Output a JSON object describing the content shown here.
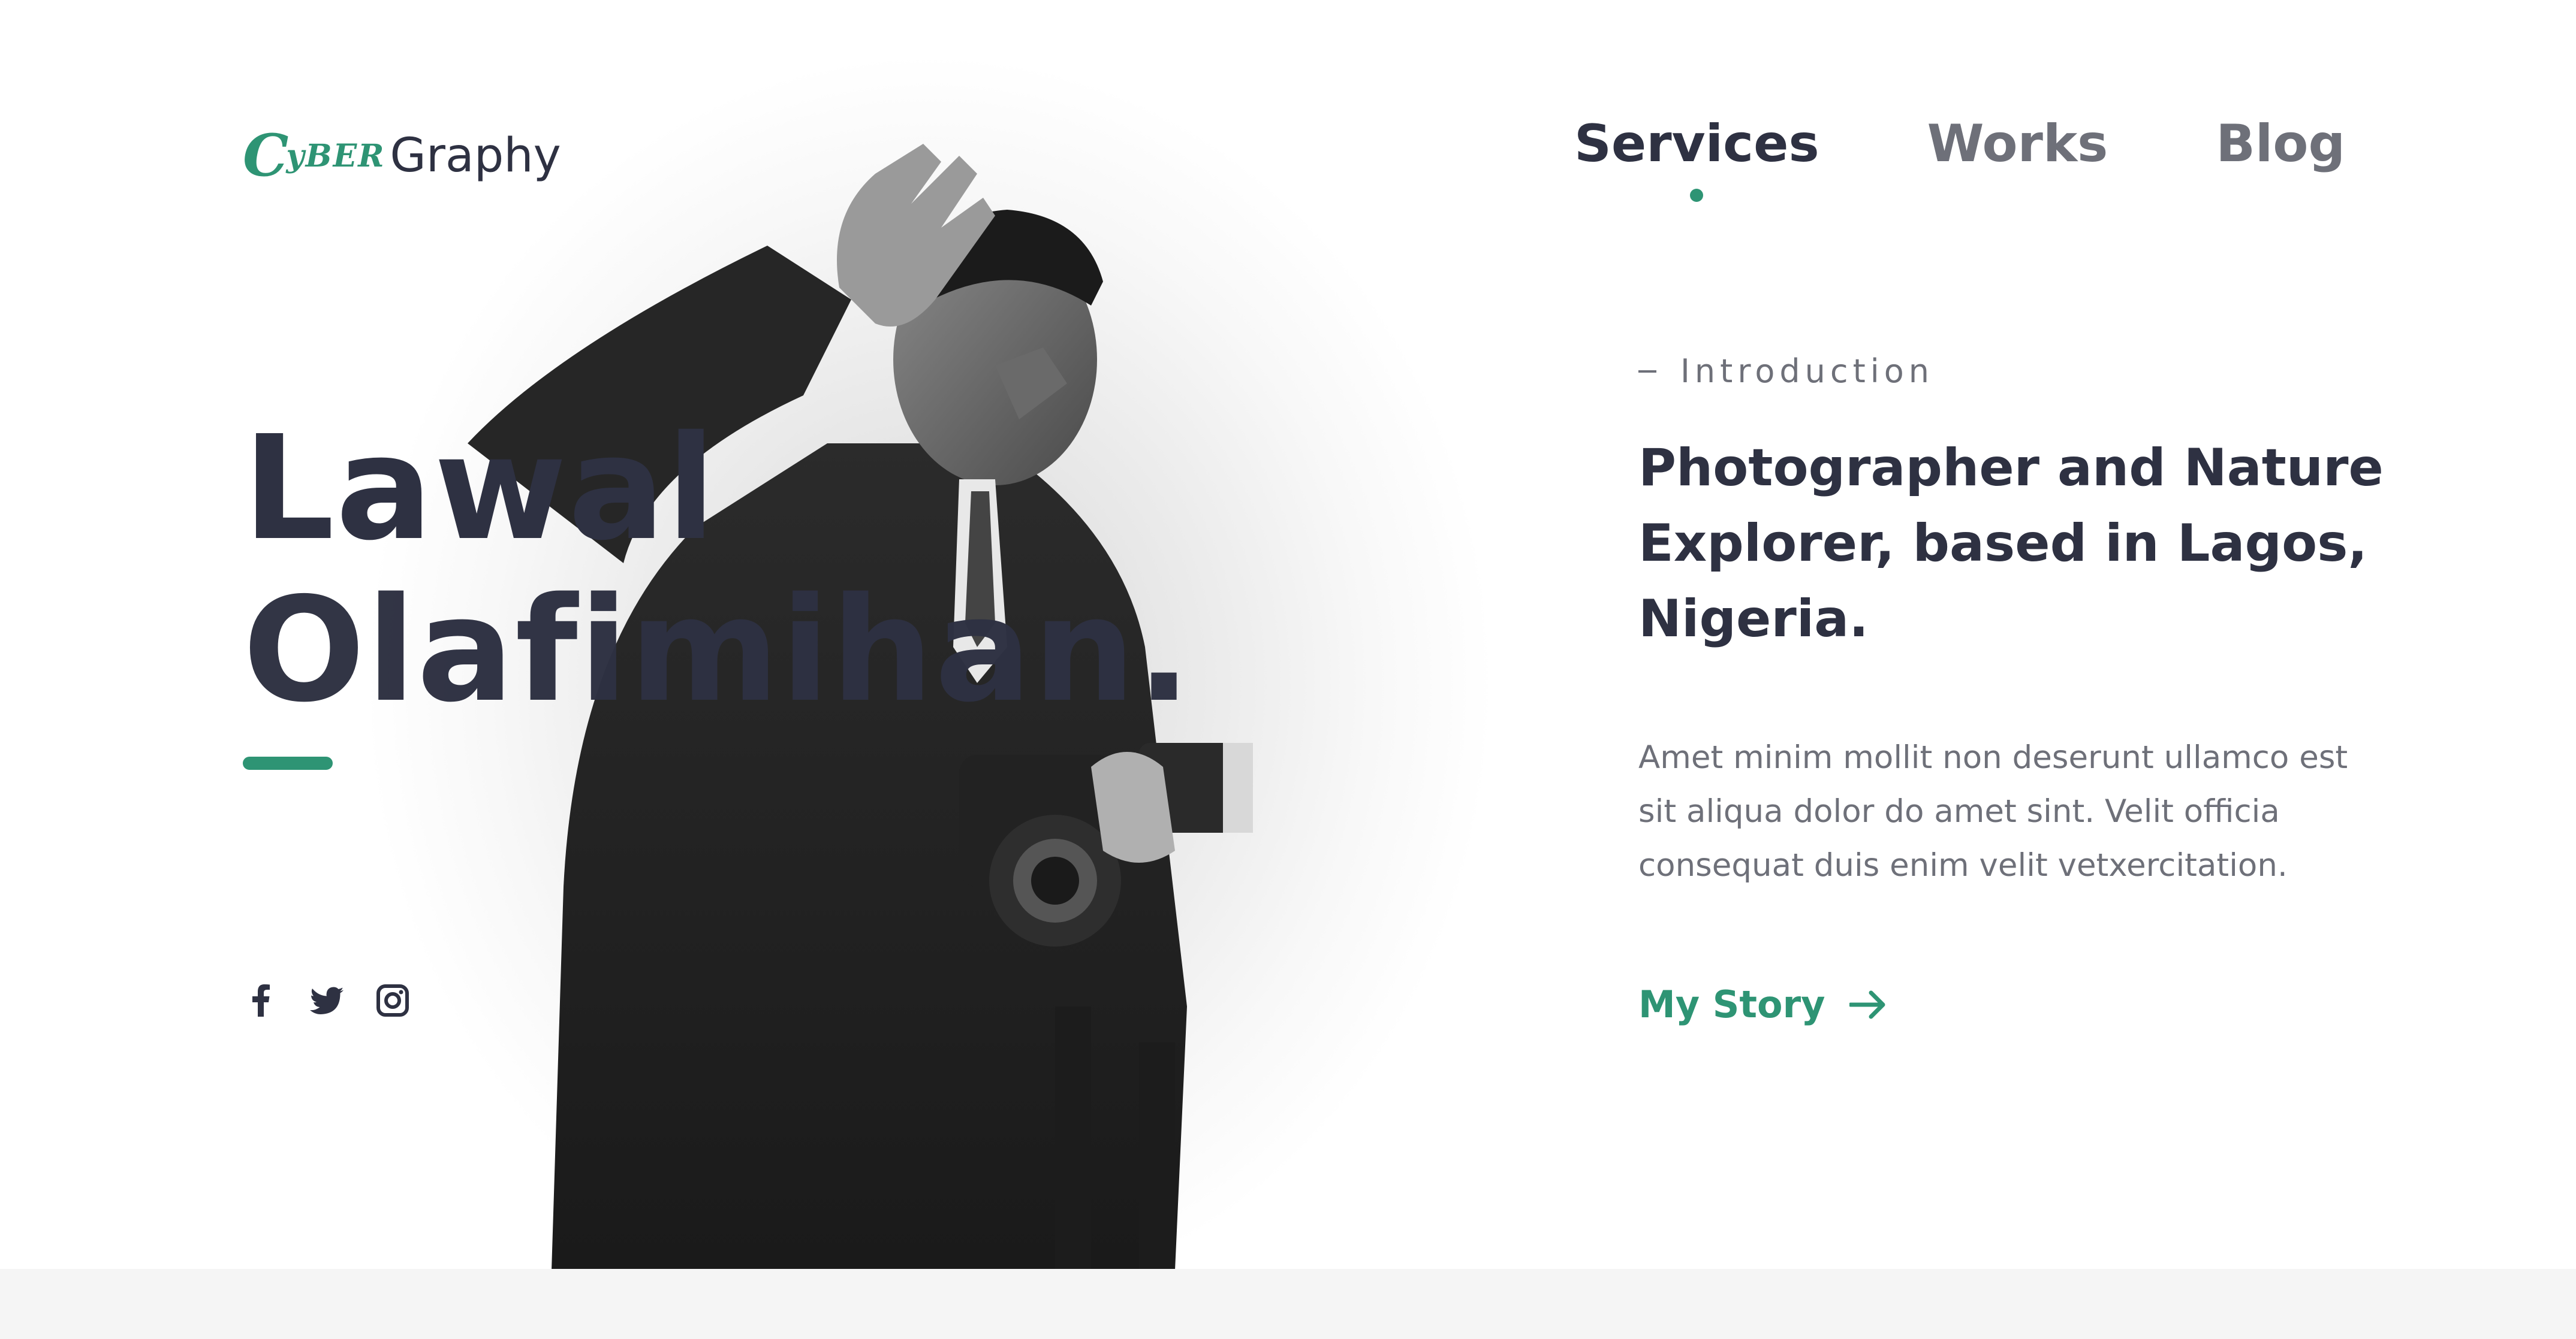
{
  "logo": {
    "mark": "C",
    "accent": "yBER",
    "word": "Graphy"
  },
  "nav": {
    "items": [
      {
        "label": "Services",
        "active": true
      },
      {
        "label": "Works",
        "active": false
      },
      {
        "label": "Blog",
        "active": false
      }
    ]
  },
  "hero": {
    "name_line1": "Lawal",
    "name_line2": "Olafimihan."
  },
  "social": {
    "icons": [
      "facebook-icon",
      "twitter-icon",
      "instagram-icon"
    ]
  },
  "intro": {
    "label": "Introduction",
    "tagline": "Photographer and Nature Explorer, based in Lagos, Nigeria.",
    "body": "Amet minim mollit non deserunt ullamco est sit aliqua dolor do amet sint. Velit officia consequat duis  enim velit  vetxercitation.",
    "cta": "My Story"
  },
  "colors": {
    "accent": "#2e9474",
    "heading": "#2e3142",
    "muted": "#6e7079",
    "footer_band": "#f5f5f5"
  }
}
